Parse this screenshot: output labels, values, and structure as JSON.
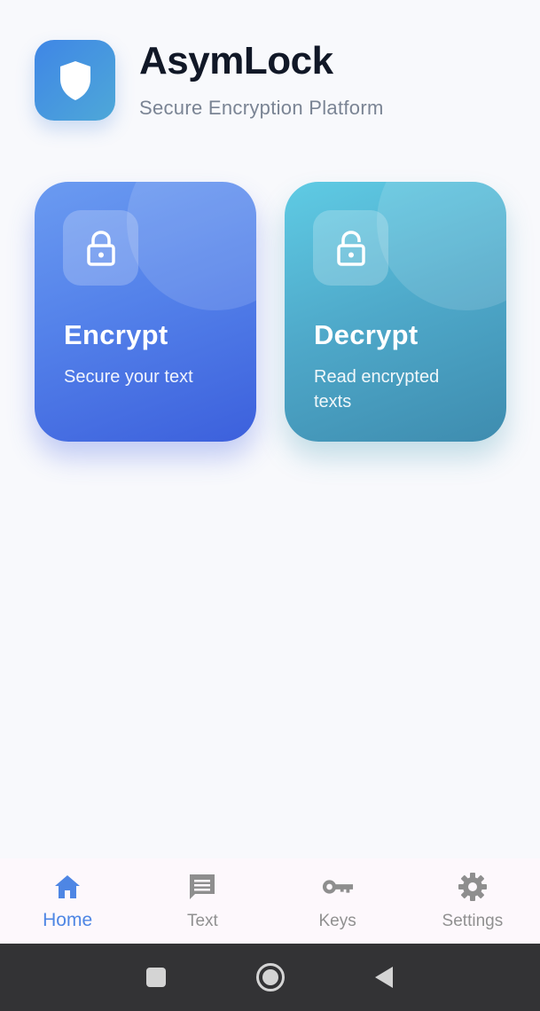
{
  "app": {
    "title": "AsymLock",
    "subtitle": "Secure Encryption Platform",
    "logo_icon": "shield-icon"
  },
  "cards": [
    {
      "title": "Encrypt",
      "description": "Secure your text",
      "icon": "lock-icon",
      "color": "#5482ea"
    },
    {
      "title": "Decrypt",
      "description": "Read encrypted texts",
      "icon": "unlock-icon",
      "color": "#4ea8c9"
    }
  ],
  "nav": {
    "active": "Home",
    "active_color": "#4e86e4",
    "items": [
      {
        "label": "Home",
        "icon": "home-icon"
      },
      {
        "label": "Text",
        "icon": "message-icon"
      },
      {
        "label": "Keys",
        "icon": "key-icon"
      },
      {
        "label": "Settings",
        "icon": "gear-icon"
      }
    ]
  },
  "system_bar": {
    "buttons": [
      "recents-icon",
      "home-circle-icon",
      "back-icon"
    ]
  }
}
